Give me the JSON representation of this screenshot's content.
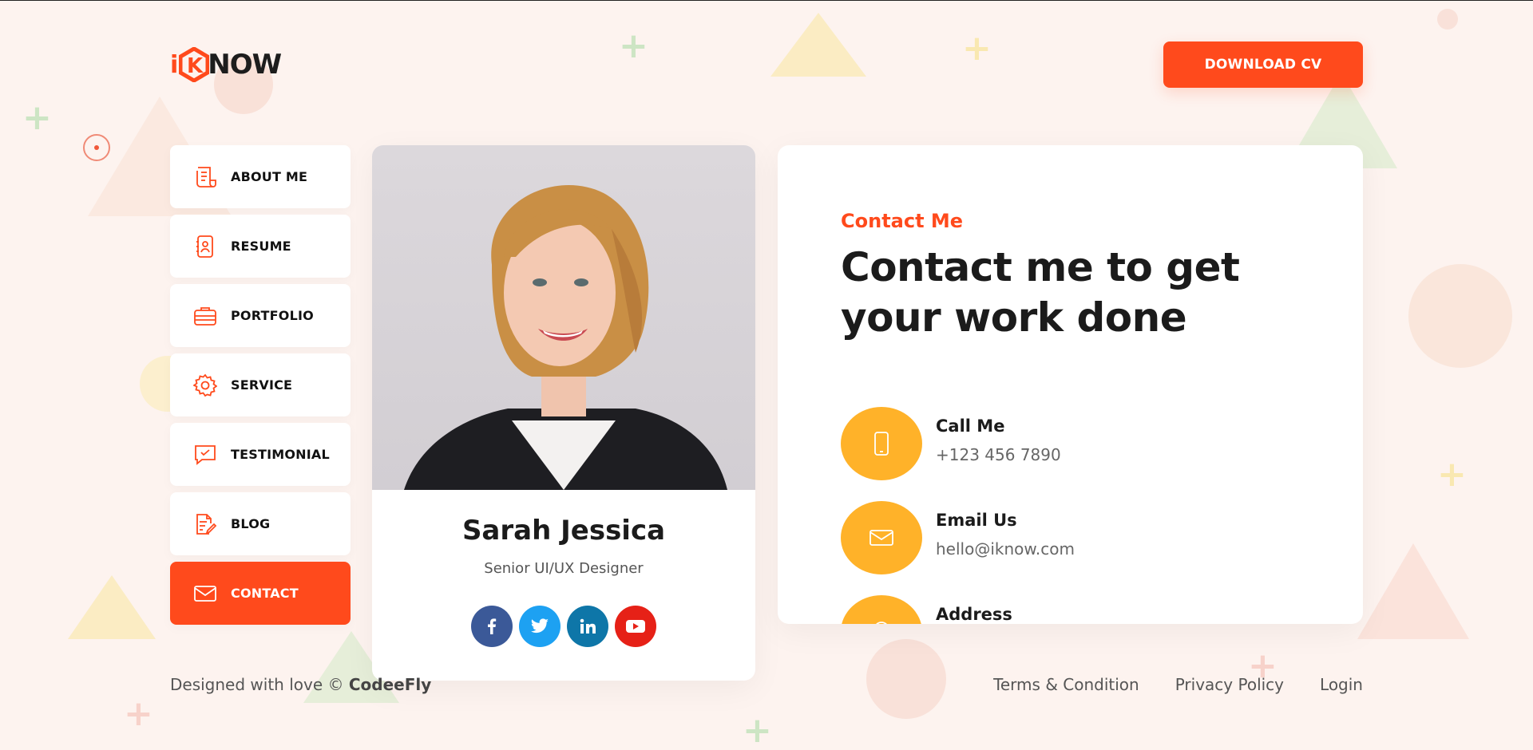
{
  "brand": {
    "logo_prefix": "i",
    "logo_mid": "K",
    "logo_suffix": "NOW",
    "accent": "#ff4a1c",
    "highlight": "#ffb229"
  },
  "header": {
    "download_label": "DOWNLOAD CV"
  },
  "sidebar": {
    "items": [
      {
        "label": "ABOUT ME",
        "icon": "document-icon",
        "active": false
      },
      {
        "label": "RESUME",
        "icon": "id-card-icon",
        "active": false
      },
      {
        "label": "PORTFOLIO",
        "icon": "briefcase-icon",
        "active": false
      },
      {
        "label": "SERVICE",
        "icon": "gear-icon",
        "active": false
      },
      {
        "label": "TESTIMONIAL",
        "icon": "chat-check-icon",
        "active": false
      },
      {
        "label": "BLOG",
        "icon": "edit-note-icon",
        "active": false
      },
      {
        "label": "CONTACT",
        "icon": "mail-icon",
        "active": true
      }
    ]
  },
  "profile": {
    "name": "Sarah Jessica",
    "title": "Senior UI/UX Designer",
    "socials": [
      {
        "name": "facebook-icon",
        "glyph": "f",
        "color": "#3b5998"
      },
      {
        "name": "twitter-icon",
        "glyph": "t",
        "color": "#1da1f2"
      },
      {
        "name": "linkedin-icon",
        "glyph": "in",
        "color": "#0e76a8"
      },
      {
        "name": "youtube-icon",
        "glyph": "▶",
        "color": "#e62117"
      }
    ]
  },
  "contact": {
    "eyebrow": "Contact Me",
    "heading": "Contact me to get your work done",
    "items": [
      {
        "label": "Call Me",
        "value": "+123 456 7890",
        "icon": "phone-icon"
      },
      {
        "label": "Email Us",
        "value": "hello@iknow.com",
        "icon": "mail-icon"
      },
      {
        "label": "Address",
        "value": "",
        "icon": "location-icon"
      }
    ]
  },
  "footer": {
    "credit_prefix": "Designed with love ©",
    "credit_brand": "CodeeFly",
    "links": [
      "Terms & Condition",
      "Privacy Policy",
      "Login"
    ]
  }
}
